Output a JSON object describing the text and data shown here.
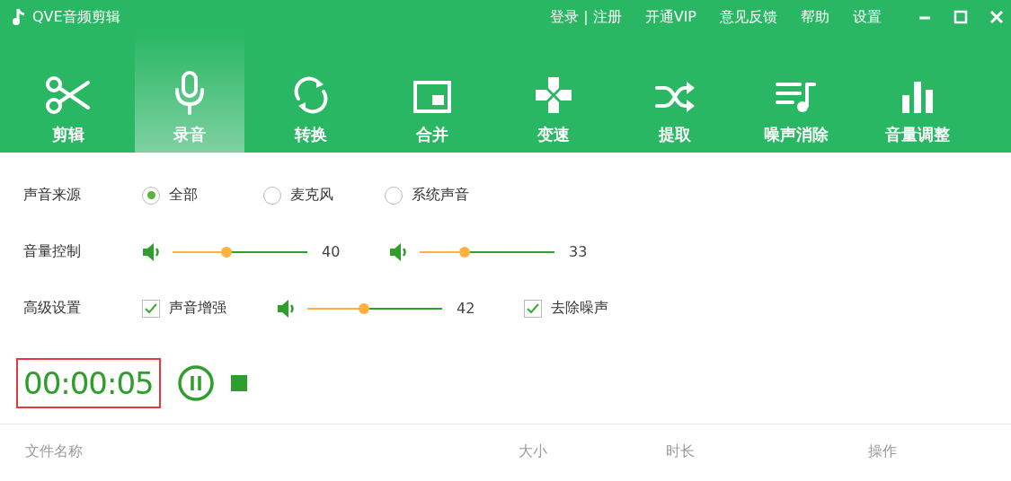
{
  "window": {
    "title": "QVE音频剪辑",
    "menu": [
      "登录 | 注册",
      "开通VIP",
      "意见反馈",
      "帮助",
      "设置"
    ]
  },
  "toolbar": [
    {
      "label": "剪辑",
      "selected": false
    },
    {
      "label": "录音",
      "selected": true
    },
    {
      "label": "转换",
      "selected": false
    },
    {
      "label": "合并",
      "selected": false
    },
    {
      "label": "变速",
      "selected": false
    },
    {
      "label": "提取",
      "selected": false
    },
    {
      "label": "噪声消除",
      "selected": false
    },
    {
      "label": "音量调整",
      "selected": false
    }
  ],
  "settings": [
    {
      "label": "声音来源",
      "items": [
        {
          "kind": "radio",
          "label": "全部",
          "selected": true
        },
        {
          "kind": "radio",
          "label": "麦克风",
          "selected": false
        },
        {
          "kind": "radio",
          "label": "系统声音",
          "selected": false
        }
      ]
    },
    {
      "label": "音量控制",
      "items": [
        {
          "kind": "slider",
          "level": 0.4,
          "reading": "40"
        },
        {
          "kind": "slider",
          "level": 0.33,
          "reading": "33"
        }
      ]
    },
    {
      "label": "高级设置",
      "items": [
        {
          "kind": "checkbox",
          "label": "声音增强",
          "checked": true
        },
        {
          "kind": "slider",
          "level": 0.42,
          "reading": "42"
        },
        {
          "kind": "checkbox",
          "label": "去除噪声",
          "checked": true
        }
      ]
    }
  ],
  "recorder": {
    "time": "00:00:05",
    "highlighted": true
  },
  "file_table": {
    "columns": [
      "文件名称",
      "大小",
      "时长",
      "操作"
    ]
  }
}
